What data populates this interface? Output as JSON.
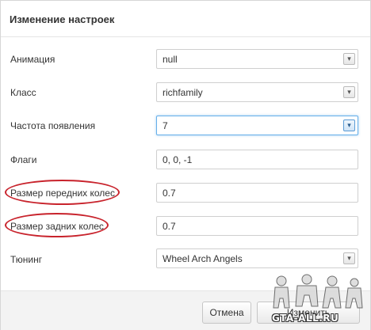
{
  "dialog": {
    "title": "Изменение настроек"
  },
  "form": {
    "rows": [
      {
        "label": "Анимация",
        "value": "null",
        "type": "select"
      },
      {
        "label": "Класс",
        "value": "richfamily",
        "type": "select"
      },
      {
        "label": "Частота появления",
        "value": "7",
        "type": "select",
        "focused": true
      },
      {
        "label": "Флаги",
        "value": "0, 0, -1",
        "type": "text"
      },
      {
        "label": "Размер передних колес",
        "value": "0.7",
        "type": "text",
        "highlighted": true
      },
      {
        "label": "Размер задних колес",
        "value": "0.7",
        "type": "text",
        "highlighted": true
      },
      {
        "label": "Тюнинг",
        "value": "Wheel Arch Angels",
        "type": "select"
      }
    ],
    "dropdown_glyph": "▾"
  },
  "footer": {
    "cancel_label": "Отмена",
    "save_label": "Изменить"
  },
  "watermark": {
    "text": "GTA-ALL.RU"
  },
  "colors": {
    "highlight_circle": "#c8232c",
    "focus_border": "#66afe9",
    "footer_bg": "#f3f3f3"
  }
}
